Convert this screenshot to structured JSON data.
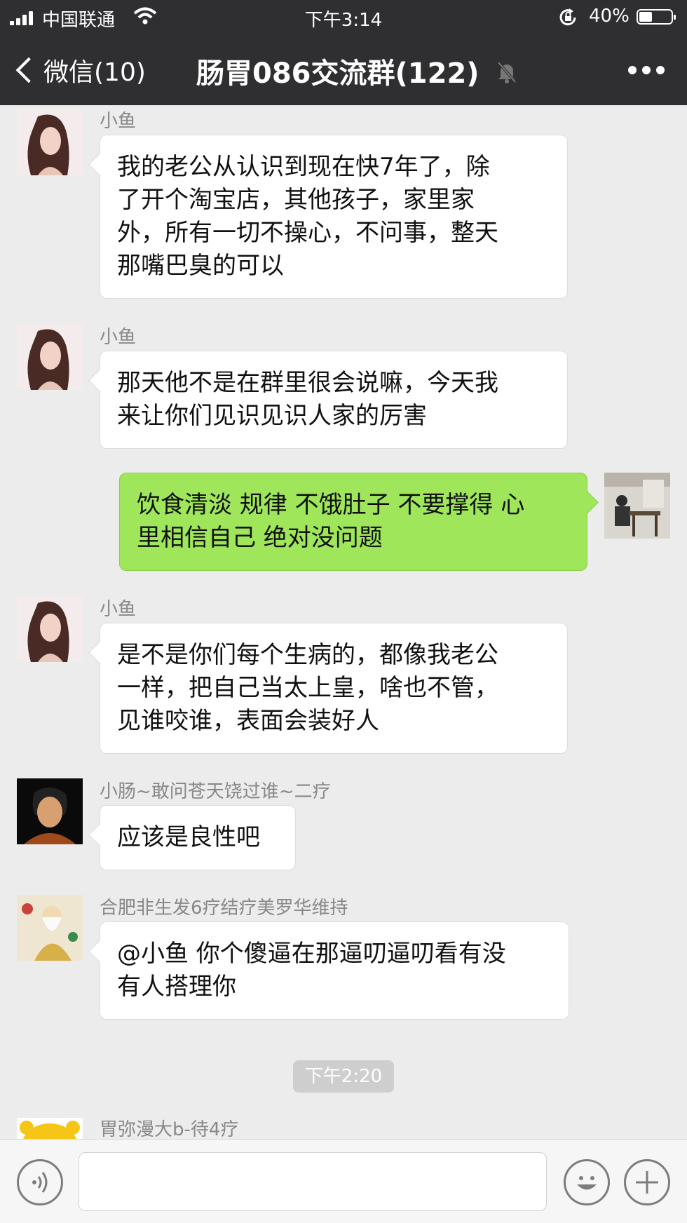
{
  "status_bar": {
    "carrier": "中国联通",
    "time": "下午3:14",
    "battery_percent": "40%",
    "battery_level": 0.4
  },
  "nav": {
    "back_label": "微信(10)",
    "title": "肠胃086交流群(122)",
    "icons": [
      "back-chevron-icon",
      "mute-bell-icon",
      "more-icon"
    ]
  },
  "messages": [
    {
      "sender": "小鱼",
      "side": "left",
      "text_lines": [
        "我的老公从认识到现在快7年了，除",
        "了开个淘宝店，其他孩子，家里家",
        "外，所有一切不操心，不问事，整天",
        "那嘴巴臭的可以"
      ]
    },
    {
      "sender": "小鱼",
      "side": "left",
      "text_lines": [
        "那天他不是在群里很会说嘛，今天我",
        "来让你们见识见识人家的厉害"
      ]
    },
    {
      "sender": "",
      "side": "right",
      "text_lines": [
        "饮食清淡 规律 不饿肚子 不要撑得 心",
        "里相信自己 绝对没问题"
      ]
    },
    {
      "sender": "小鱼",
      "side": "left",
      "text_lines": [
        "是不是你们每个生病的，都像我老公",
        "一样，把自己当太上皇，啥也不管，",
        "见谁咬谁，表面会装好人"
      ]
    },
    {
      "sender": "小肠~敢问苍天饶过谁~二疗",
      "side": "left",
      "text_lines": [
        "应该是良性吧"
      ]
    },
    {
      "sender": "合肥非生发6疗结疗美罗华维持",
      "side": "left",
      "text_lines": [
        "@小鱼 你个傻逼在那逼叨逼叨看有没",
        "有人搭理你"
      ]
    }
  ],
  "timestamp": "下午2:20",
  "partial_message": {
    "sender": "胃弥漫大b-待4疗"
  },
  "input_bar": {
    "value": "",
    "icons": [
      "voice-icon",
      "emoji-icon",
      "plus-icon"
    ]
  },
  "colors": {
    "header_bg": "#2f2f31",
    "chat_bg": "#ececec",
    "own_bubble": "#9fe65b",
    "other_bubble": "#ffffff"
  }
}
